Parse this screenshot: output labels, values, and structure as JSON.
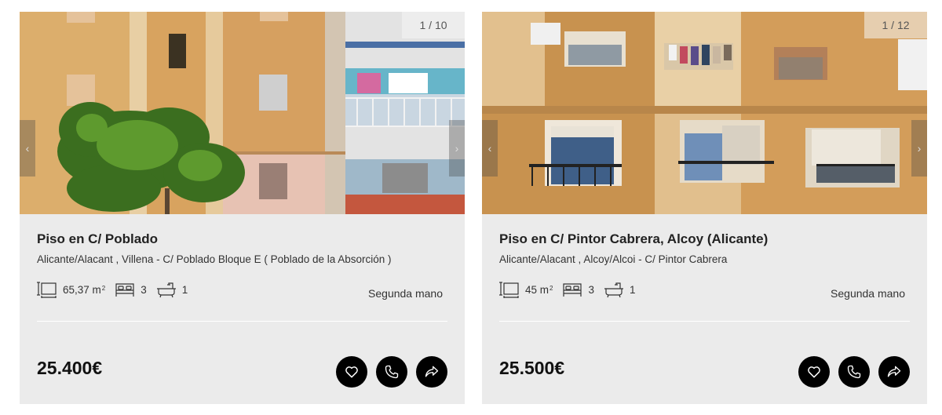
{
  "listings": [
    {
      "photo_counter": "1 / 10",
      "title": "Piso en C/ Poblado",
      "location": "Alicante/Alacant , Villena - C/ Poblado Bloque E ( Poblado de la Absorción )",
      "area": "65,37 m",
      "area_sup": "2",
      "bedrooms": "3",
      "bathrooms": "1",
      "condition": "Segunda mano",
      "price": "25.400€"
    },
    {
      "photo_counter": "1 / 12",
      "title": "Piso en C/ Pintor Cabrera, Alcoy (Alicante)",
      "location": "Alicante/Alacant , Alcoy/Alcoi - C/ Pintor Cabrera",
      "area": "45 m",
      "area_sup": "2",
      "bedrooms": "3",
      "bathrooms": "1",
      "condition": "Segunda mano",
      "price": "25.500€"
    }
  ],
  "icons": {
    "prev": "chevron-left-icon",
    "next": "chevron-right-icon",
    "area": "area-icon",
    "bed": "bed-icon",
    "bath": "bathtub-icon",
    "favorite": "heart-icon",
    "call": "phone-icon",
    "share": "share-icon"
  }
}
